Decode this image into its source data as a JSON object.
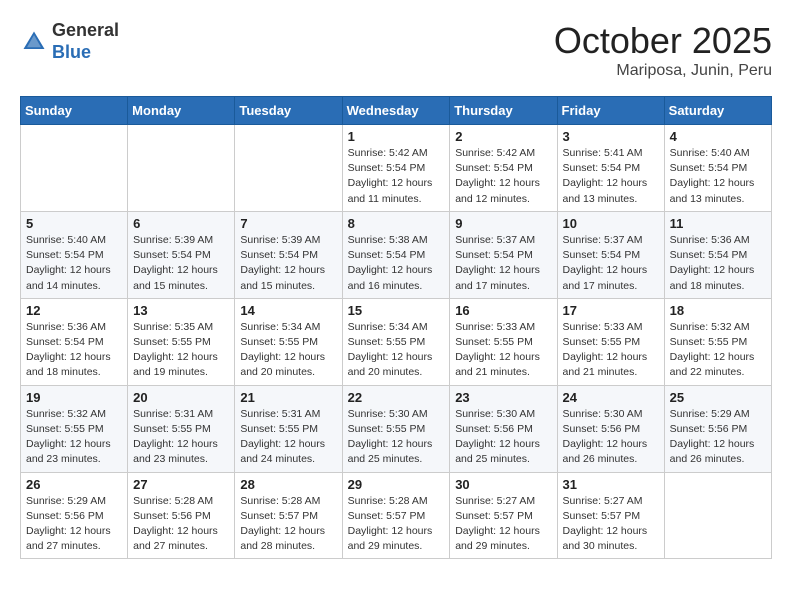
{
  "header": {
    "logo": {
      "general": "General",
      "blue": "Blue"
    },
    "title": "October 2025",
    "location": "Mariposa, Junin, Peru"
  },
  "weekdays": [
    "Sunday",
    "Monday",
    "Tuesday",
    "Wednesday",
    "Thursday",
    "Friday",
    "Saturday"
  ],
  "weeks": [
    [
      {
        "day": "",
        "info": ""
      },
      {
        "day": "",
        "info": ""
      },
      {
        "day": "",
        "info": ""
      },
      {
        "day": "1",
        "info": "Sunrise: 5:42 AM\nSunset: 5:54 PM\nDaylight: 12 hours\nand 11 minutes."
      },
      {
        "day": "2",
        "info": "Sunrise: 5:42 AM\nSunset: 5:54 PM\nDaylight: 12 hours\nand 12 minutes."
      },
      {
        "day": "3",
        "info": "Sunrise: 5:41 AM\nSunset: 5:54 PM\nDaylight: 12 hours\nand 13 minutes."
      },
      {
        "day": "4",
        "info": "Sunrise: 5:40 AM\nSunset: 5:54 PM\nDaylight: 12 hours\nand 13 minutes."
      }
    ],
    [
      {
        "day": "5",
        "info": "Sunrise: 5:40 AM\nSunset: 5:54 PM\nDaylight: 12 hours\nand 14 minutes."
      },
      {
        "day": "6",
        "info": "Sunrise: 5:39 AM\nSunset: 5:54 PM\nDaylight: 12 hours\nand 15 minutes."
      },
      {
        "day": "7",
        "info": "Sunrise: 5:39 AM\nSunset: 5:54 PM\nDaylight: 12 hours\nand 15 minutes."
      },
      {
        "day": "8",
        "info": "Sunrise: 5:38 AM\nSunset: 5:54 PM\nDaylight: 12 hours\nand 16 minutes."
      },
      {
        "day": "9",
        "info": "Sunrise: 5:37 AM\nSunset: 5:54 PM\nDaylight: 12 hours\nand 17 minutes."
      },
      {
        "day": "10",
        "info": "Sunrise: 5:37 AM\nSunset: 5:54 PM\nDaylight: 12 hours\nand 17 minutes."
      },
      {
        "day": "11",
        "info": "Sunrise: 5:36 AM\nSunset: 5:54 PM\nDaylight: 12 hours\nand 18 minutes."
      }
    ],
    [
      {
        "day": "12",
        "info": "Sunrise: 5:36 AM\nSunset: 5:54 PM\nDaylight: 12 hours\nand 18 minutes."
      },
      {
        "day": "13",
        "info": "Sunrise: 5:35 AM\nSunset: 5:55 PM\nDaylight: 12 hours\nand 19 minutes."
      },
      {
        "day": "14",
        "info": "Sunrise: 5:34 AM\nSunset: 5:55 PM\nDaylight: 12 hours\nand 20 minutes."
      },
      {
        "day": "15",
        "info": "Sunrise: 5:34 AM\nSunset: 5:55 PM\nDaylight: 12 hours\nand 20 minutes."
      },
      {
        "day": "16",
        "info": "Sunrise: 5:33 AM\nSunset: 5:55 PM\nDaylight: 12 hours\nand 21 minutes."
      },
      {
        "day": "17",
        "info": "Sunrise: 5:33 AM\nSunset: 5:55 PM\nDaylight: 12 hours\nand 21 minutes."
      },
      {
        "day": "18",
        "info": "Sunrise: 5:32 AM\nSunset: 5:55 PM\nDaylight: 12 hours\nand 22 minutes."
      }
    ],
    [
      {
        "day": "19",
        "info": "Sunrise: 5:32 AM\nSunset: 5:55 PM\nDaylight: 12 hours\nand 23 minutes."
      },
      {
        "day": "20",
        "info": "Sunrise: 5:31 AM\nSunset: 5:55 PM\nDaylight: 12 hours\nand 23 minutes."
      },
      {
        "day": "21",
        "info": "Sunrise: 5:31 AM\nSunset: 5:55 PM\nDaylight: 12 hours\nand 24 minutes."
      },
      {
        "day": "22",
        "info": "Sunrise: 5:30 AM\nSunset: 5:55 PM\nDaylight: 12 hours\nand 25 minutes."
      },
      {
        "day": "23",
        "info": "Sunrise: 5:30 AM\nSunset: 5:56 PM\nDaylight: 12 hours\nand 25 minutes."
      },
      {
        "day": "24",
        "info": "Sunrise: 5:30 AM\nSunset: 5:56 PM\nDaylight: 12 hours\nand 26 minutes."
      },
      {
        "day": "25",
        "info": "Sunrise: 5:29 AM\nSunset: 5:56 PM\nDaylight: 12 hours\nand 26 minutes."
      }
    ],
    [
      {
        "day": "26",
        "info": "Sunrise: 5:29 AM\nSunset: 5:56 PM\nDaylight: 12 hours\nand 27 minutes."
      },
      {
        "day": "27",
        "info": "Sunrise: 5:28 AM\nSunset: 5:56 PM\nDaylight: 12 hours\nand 27 minutes."
      },
      {
        "day": "28",
        "info": "Sunrise: 5:28 AM\nSunset: 5:57 PM\nDaylight: 12 hours\nand 28 minutes."
      },
      {
        "day": "29",
        "info": "Sunrise: 5:28 AM\nSunset: 5:57 PM\nDaylight: 12 hours\nand 29 minutes."
      },
      {
        "day": "30",
        "info": "Sunrise: 5:27 AM\nSunset: 5:57 PM\nDaylight: 12 hours\nand 29 minutes."
      },
      {
        "day": "31",
        "info": "Sunrise: 5:27 AM\nSunset: 5:57 PM\nDaylight: 12 hours\nand 30 minutes."
      },
      {
        "day": "",
        "info": ""
      }
    ]
  ]
}
